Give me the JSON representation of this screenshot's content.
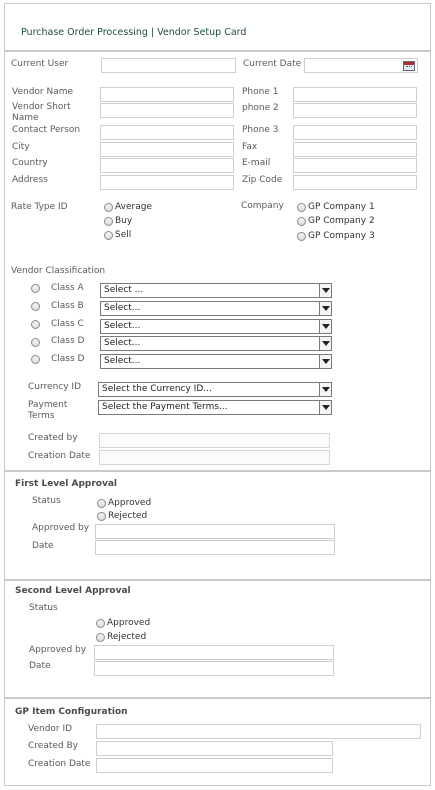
{
  "header": {
    "title": "Purchase Order Processing | Vendor Setup Card"
  },
  "current_user": {
    "label": "Current User",
    "value": ""
  },
  "current_date": {
    "label": "Current Date",
    "value": ""
  },
  "vendor": {
    "name_label": "Vendor Name",
    "short_name_label": "Vendor Short Name",
    "contact_label": "Contact Person",
    "city_label": "City",
    "country_label": "Country",
    "address_label": "Address",
    "phone1_label": "Phone 1",
    "phone2_label": "phone 2",
    "phone3_label": "Phone 3",
    "fax_label": "Fax",
    "email_label": "E-mail",
    "zip_label": "Zip Code"
  },
  "rate_type": {
    "label": "Rate Type ID",
    "options": [
      "Average",
      "Buy",
      "Sell"
    ]
  },
  "company": {
    "label": "Company",
    "options": [
      "GP Company 1",
      "GP Company 2",
      "GP Company 3"
    ]
  },
  "classification": {
    "label": "Vendor Classification",
    "classes": [
      {
        "label": "Class A",
        "selected": "Select ..."
      },
      {
        "label": "Class B",
        "selected": "Select..."
      },
      {
        "label": "Class C",
        "selected": "Select..."
      },
      {
        "label": "Class D",
        "selected": "Select..."
      },
      {
        "label": "Class D",
        "selected": "Select..."
      }
    ]
  },
  "currency": {
    "label": "Currency ID",
    "selected": "Select the Currency ID..."
  },
  "payment": {
    "label": "Payment Terms",
    "selected": "Select the Payment Terms..."
  },
  "created_by": {
    "label": "Created by",
    "value": ""
  },
  "creation_date": {
    "label": "Creation Date",
    "value": ""
  },
  "first_approval": {
    "title": "First Level Approval",
    "status_label": "Status",
    "options": [
      "Approved",
      "Rejected"
    ],
    "approved_by_label": "Approved by",
    "date_label": "Date"
  },
  "second_approval": {
    "title": "Second Level Approval",
    "status_label": "Status",
    "options": [
      "Approved",
      "Rejected"
    ],
    "approved_by_label": "Approved by",
    "date_label": "Date"
  },
  "gp_item": {
    "title": "GP Item Configuration",
    "vendor_id_label": "Vendor ID",
    "created_by_label": "Created By",
    "creation_date_label": "Creation Date"
  },
  "colors": {
    "title_text": "#1f4e3d",
    "border": "#c9c9c9"
  }
}
